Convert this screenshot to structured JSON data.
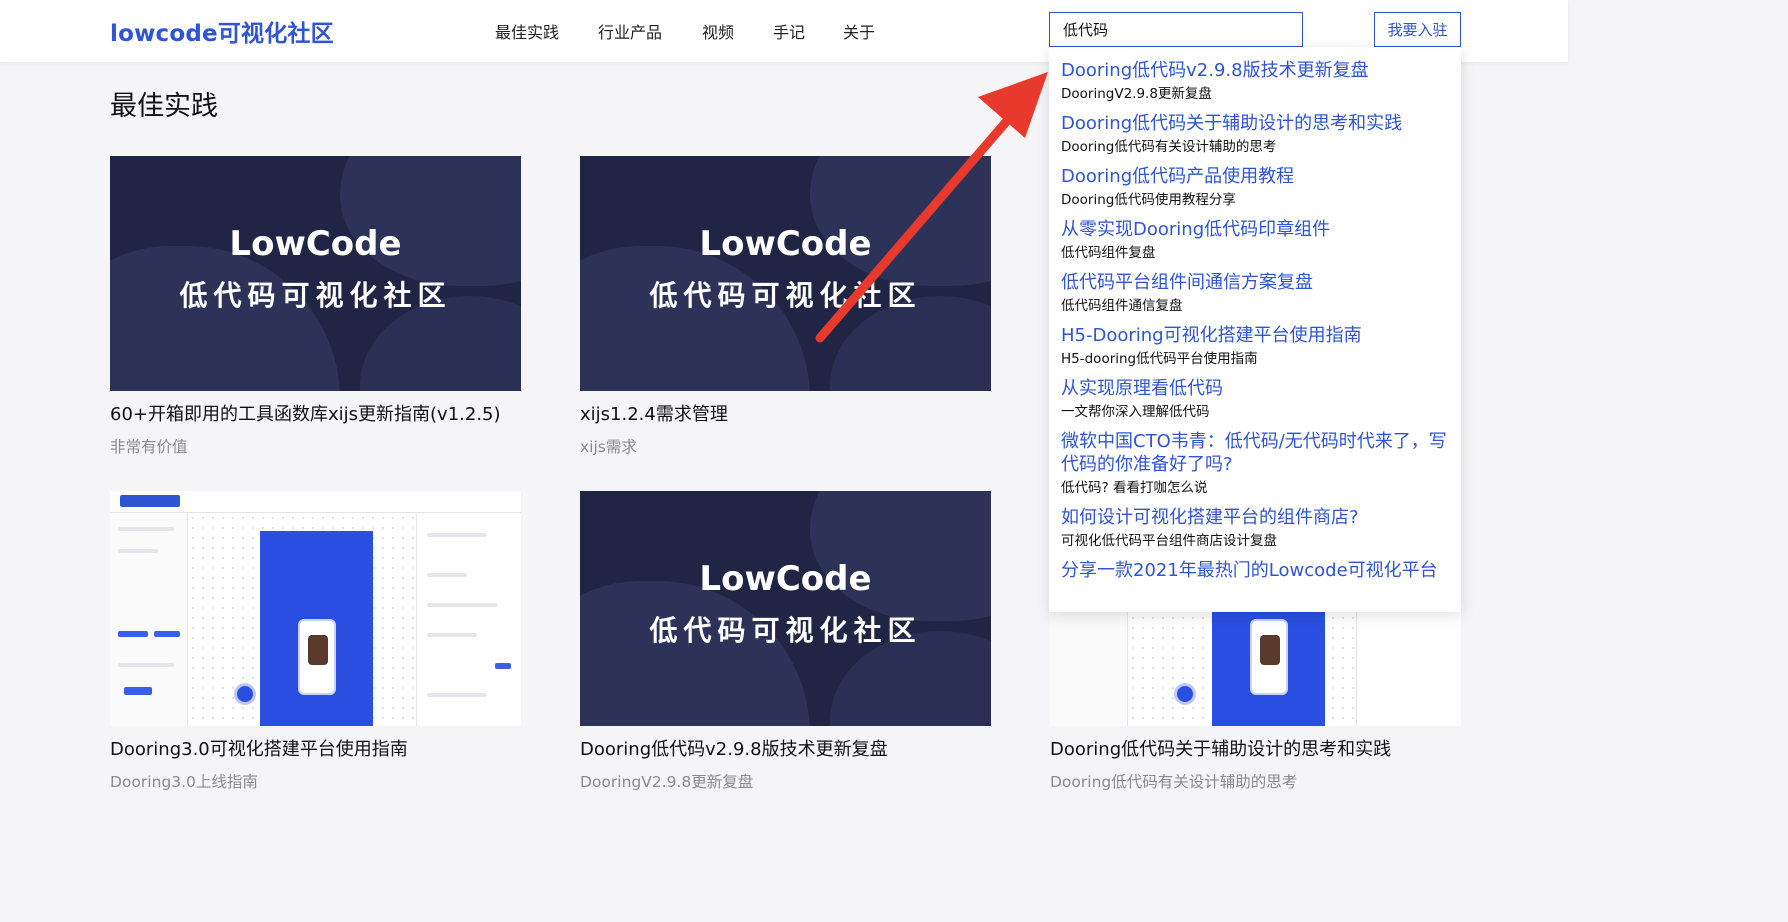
{
  "header": {
    "logo": "lowcode可视化社区",
    "nav": [
      "最佳实践",
      "行业产品",
      "视频",
      "手记",
      "关于"
    ],
    "search_value": "低代码",
    "join_label": "我要入驻"
  },
  "section_title": "最佳实践",
  "thumb_text": {
    "line1": "LowCode",
    "line2": "低代码可视化社区"
  },
  "cards": [
    {
      "title": "60+开箱即用的工具函数库xijs更新指南(v1.2.5)",
      "desc": "非常有价值"
    },
    {
      "title": "xijs1.2.4需求管理",
      "desc": "xijs需求"
    },
    {
      "title": "Dooring3.0可视化搭建平台使用指南",
      "desc": "Dooring3.0上线指南"
    },
    {
      "title": "Dooring低代码v2.9.8版技术更新复盘",
      "desc": "DooringV2.9.8更新复盘"
    },
    {
      "title": "Dooring低代码关于辅助设计的思考和实践",
      "desc": "Dooring低代码有关设计辅助的思考"
    }
  ],
  "dropdown": [
    {
      "title": "Dooring低代码v2.9.8版技术更新复盘",
      "desc": "DooringV2.9.8更新复盘"
    },
    {
      "title": "Dooring低代码关于辅助设计的思考和实践",
      "desc": "Dooring低代码有关设计辅助的思考"
    },
    {
      "title": "Dooring低代码产品使用教程",
      "desc": "Dooring低代码使用教程分享"
    },
    {
      "title": "从零实现Dooring低代码印章组件",
      "desc": "低代码组件复盘"
    },
    {
      "title": "低代码平台组件间通信方案复盘",
      "desc": "低代码组件通信复盘"
    },
    {
      "title": "H5-Dooring可视化搭建平台使用指南",
      "desc": "H5-dooring低代码平台使用指南"
    },
    {
      "title": "从实现原理看低代码",
      "desc": "一文帮你深入理解低代码"
    },
    {
      "title": "微软中国CTO韦青：低代码/无代码时代来了，写代码的你准备好了吗?",
      "desc": "低代码? 看看打咖怎么说"
    },
    {
      "title": "如何设计可视化搭建平台的组件商店?",
      "desc": "可视化低代码平台组件商店设计复盘"
    },
    {
      "title": "分享一款2021年最热门的Lowcode可视化平台",
      "desc": ""
    }
  ],
  "colors": {
    "accent": "#2f55d4",
    "thumb_bg": "#212545",
    "annotation_arrow": "#e8392d"
  }
}
